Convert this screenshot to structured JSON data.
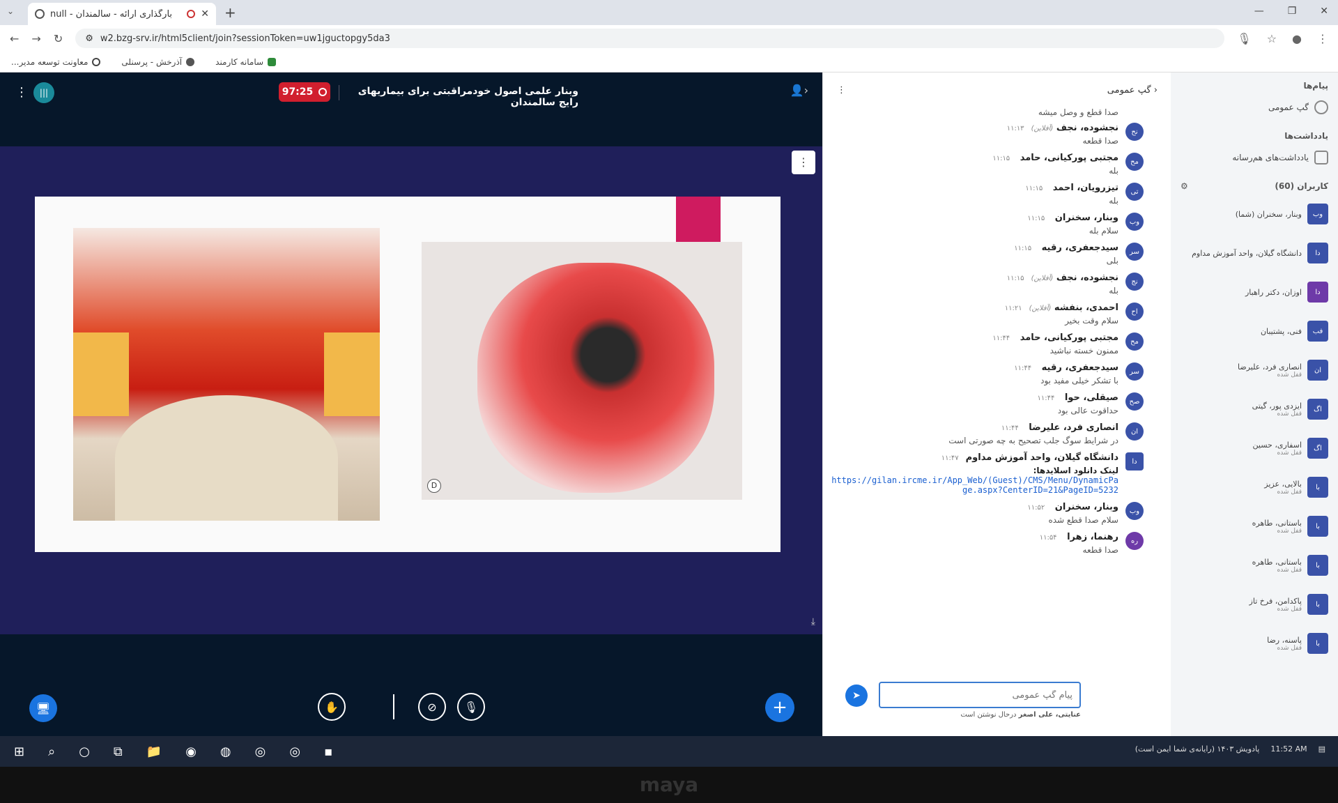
{
  "browser": {
    "tab_title": "null - بارگذاری ارائه - سالمندان",
    "url": "w2.bzg-srv.ir/html5client/join?sessionToken=uw1jguctopgy5da3",
    "bookmarks": [
      "سامانه کارمند",
      "آذرخش - پرسنلی",
      "معاونت توسعه مدیر..."
    ]
  },
  "meeting": {
    "logo": "|||",
    "timer": "97:25",
    "title": "وبنار علمی اصول خودمراقبتی برای بیماریهای رایج سالمندان"
  },
  "slide": {
    "accent_color": "#cf1b5f",
    "right_image_label": "D"
  },
  "chat": {
    "header": "گپ عمومی",
    "first_line": "صدا قطع و وصل میشه",
    "messages": [
      {
        "initials": "نح",
        "name": "نجشوده، نجف",
        "status": "(آفلاین)",
        "time": "۱۱:۱۳",
        "text": "صدا قطعه"
      },
      {
        "initials": "مح",
        "name": "مجتبی پورکیانی، حامد",
        "status": "",
        "time": "۱۱:۱۵",
        "text": "بله"
      },
      {
        "initials": "تی",
        "name": "تیزرویان، احمد",
        "status": "",
        "time": "۱۱:۱۵",
        "text": "بله"
      },
      {
        "initials": "وب",
        "name": "وبنار، سخنران",
        "status": "",
        "time": "۱۱:۱۵",
        "text": "سلام بله"
      },
      {
        "initials": "سر",
        "name": "سیدجعفری، رقیه",
        "status": "",
        "time": "۱۱:۱۵",
        "text": "بلی"
      },
      {
        "initials": "نج",
        "name": "نجشوده، نجف",
        "status": "(آفلاین)",
        "time": "۱۱:۱۵",
        "text": "بله"
      },
      {
        "initials": "اح",
        "name": "احمدی، بنفشه",
        "status": "(آفلاین)",
        "time": "۱۱:۲۱",
        "text": "سلام وقت بخیر"
      },
      {
        "initials": "مح",
        "name": "مجتبی پورکیانی، حامد",
        "status": "",
        "time": "۱۱:۴۴",
        "text": "ممنون خسته نباشید"
      },
      {
        "initials": "سر",
        "name": "سیدجعفری، رقیه",
        "status": "",
        "time": "۱۱:۴۴",
        "text": "با تشکر خیلی مفید بود"
      },
      {
        "initials": "صح",
        "name": "صیقلی، حوا",
        "status": "",
        "time": "۱۱:۴۴",
        "text": "حداقوت عالی بود"
      },
      {
        "initials": "ان",
        "name": "انصاری فرد، علیرضا",
        "status": "",
        "time": "۱۱:۴۴",
        "text": "در شرایط سوگ جلب تصحیح به چه صورتی است"
      }
    ],
    "link_message": {
      "initials": "دا",
      "name": "دانشگاه گیلان، واحد آموزش مداوم",
      "time": "۱۱:۴۷",
      "text": "لینک دانلود اسلایدها:",
      "link": "https://gilan.ircme.ir/App_Web/(Guest)/CMS/Menu/DynamicPage.aspx?CenterID=21&PageID=5232"
    },
    "tail_messages": [
      {
        "initials": "وب",
        "name": "وبنار، سخنران",
        "time": "۱۱:۵۲",
        "text": "سلام صدا قطع شده"
      },
      {
        "initials": "ره",
        "name": "رهنما، زهرا",
        "time": "۱۱:۵۴",
        "text": "صدا قطعه"
      }
    ],
    "input_placeholder": "پیام گپ عمومی",
    "typing_name": "عنایتی، علی اصغر",
    "typing_suffix": "درحال نوشتن است"
  },
  "side": {
    "messages_h": "پیام‌ها",
    "public_chat": "گپ عمومی",
    "notes_h": "یادداشت‌ها",
    "shared_notes": "یادداشت‌های هم‌رسانه",
    "users_h": "کاربران (60)",
    "users": [
      {
        "initials": "وب",
        "name": "وبنار، سخنران (شما)",
        "status": "",
        "color": "#3a52a8"
      },
      {
        "initials": "دا",
        "name": "دانشگاه گیلان، واحد آموزش مداوم",
        "status": "",
        "color": "#3a52a8"
      },
      {
        "initials": "دا",
        "name": "اوزان، دکتر راهبار",
        "status": "",
        "color": "#6e3aa8"
      },
      {
        "initials": "فب",
        "name": "فنی، پشتیبان",
        "status": "",
        "color": "#3a52a8"
      },
      {
        "initials": "ان",
        "name": "انصاری فرد، علیرضا",
        "status": "قفل شده",
        "color": "#3a52a8"
      },
      {
        "initials": "اگ",
        "name": "ایزدی پور، گیتی",
        "status": "قفل شده",
        "color": "#3a52a8"
      },
      {
        "initials": "اگ",
        "name": "اسفاری، حسین",
        "status": "قفل شده",
        "color": "#3a52a8"
      },
      {
        "initials": "با",
        "name": "بالایی، عزیز",
        "status": "قفل شده",
        "color": "#3a52a8"
      },
      {
        "initials": "با",
        "name": "باستانی، طاهره",
        "status": "قفل شده",
        "color": "#3a52a8"
      },
      {
        "initials": "با",
        "name": "باستانی، طاهره",
        "status": "قفل شده",
        "color": "#3a52a8"
      },
      {
        "initials": "با",
        "name": "پاکدامن، فرخ تاز",
        "status": "قفل شده",
        "color": "#3a52a8"
      },
      {
        "initials": "با",
        "name": "پاسنه، رضا",
        "status": "قفل شده",
        "color": "#3a52a8"
      }
    ]
  },
  "taskbar": {
    "clock": "11:52 AM",
    "notice": "پادویش ۱۴۰۳ (رایانه‌ی شما ایمن است)"
  },
  "bezel": "maya"
}
